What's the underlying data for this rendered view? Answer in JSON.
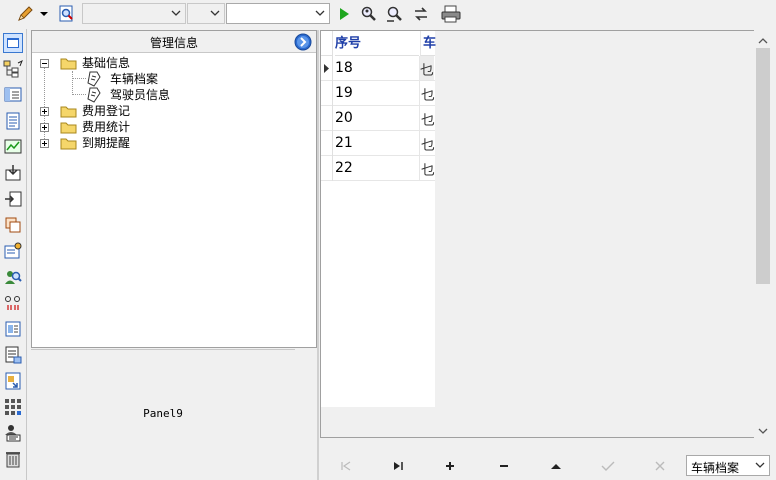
{
  "toolbar": {
    "combo1_value": "",
    "combo2_value": "",
    "combo3_value": ""
  },
  "tree": {
    "title": "管理信息",
    "nodes": [
      {
        "label": "基础信息"
      },
      {
        "label": "车辆档案"
      },
      {
        "label": "驾驶员信息"
      },
      {
        "label": "费用登记"
      },
      {
        "label": "费用统计"
      },
      {
        "label": "到期提醒"
      }
    ]
  },
  "panel9": {
    "label": "Panel9"
  },
  "grid": {
    "columns": [
      "序号",
      "车"
    ],
    "rows": [
      {
        "seq": "18",
        "col2": "乜"
      },
      {
        "seq": "19",
        "col2": "乜"
      },
      {
        "seq": "20",
        "col2": "乜"
      },
      {
        "seq": "21",
        "col2": "乜"
      },
      {
        "seq": "22",
        "col2": "乜"
      }
    ]
  },
  "navigator": {
    "selected_table": "车辆档案"
  },
  "colors": {
    "header_text": "#1f3fa8",
    "play_green": "#1fa61f",
    "accent_blue": "#1e64c8"
  }
}
